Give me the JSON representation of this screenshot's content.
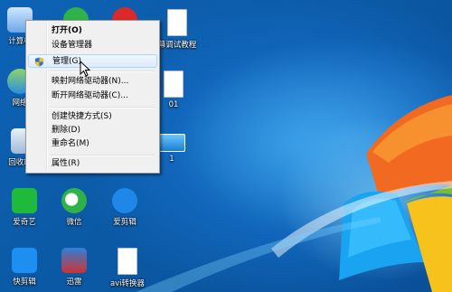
{
  "desktop": {
    "icons": [
      {
        "label": "计算机"
      },
      {
        "label": ""
      },
      {
        "label": ""
      },
      {
        "label": "幕调试教程"
      },
      {
        "label": "网络"
      },
      {
        "label": "01"
      },
      {
        "label": "回收站"
      },
      {
        "label": "1"
      },
      {
        "label": "爱奇艺"
      },
      {
        "label": "微信"
      },
      {
        "label": "爱剪辑"
      },
      {
        "label": "快剪辑"
      },
      {
        "label": "迅雷"
      },
      {
        "label": "avi转换器"
      }
    ]
  },
  "context_menu": {
    "items": [
      {
        "label": "打开(O)"
      },
      {
        "label": "设备管理器"
      },
      {
        "label": "管理(G)"
      },
      {
        "label": "映射网络驱动器(N)..."
      },
      {
        "label": "断开网络驱动器(C)..."
      },
      {
        "label": "创建快捷方式(S)"
      },
      {
        "label": "删除(D)"
      },
      {
        "label": "重命名(M)"
      },
      {
        "label": "属性(R)"
      }
    ]
  }
}
